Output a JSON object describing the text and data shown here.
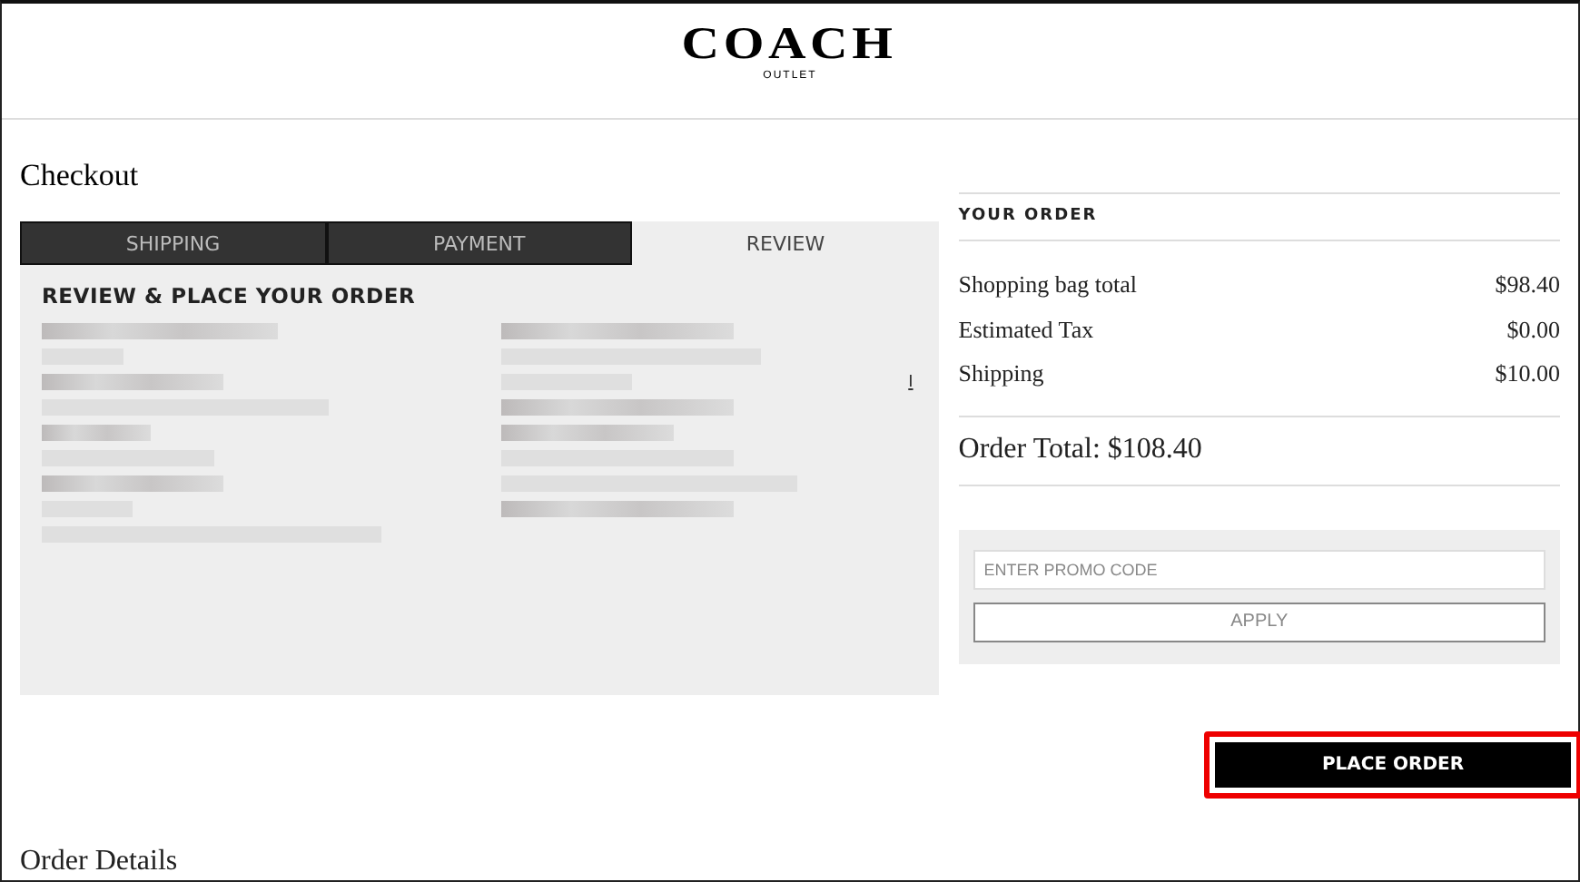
{
  "header": {
    "logo": "COACH",
    "sublogo": "OUTLET"
  },
  "page_title": "Checkout",
  "tabs": [
    {
      "label": "SHIPPING",
      "selected": false
    },
    {
      "label": "PAYMENT",
      "selected": false
    },
    {
      "label": "REVIEW",
      "selected": true
    }
  ],
  "review": {
    "heading": "REVIEW & PLACE YOUR ORDER",
    "edit_link": "I"
  },
  "summary": {
    "heading": "YOUR ORDER",
    "lines": [
      {
        "label": "Shopping bag total",
        "amount": "$98.40"
      },
      {
        "label": "Estimated Tax",
        "amount": "$0.00"
      },
      {
        "label": "Shipping",
        "amount": "$10.00"
      }
    ],
    "total": "Order Total: $108.40"
  },
  "promo": {
    "placeholder": "ENTER PROMO CODE",
    "button": "APPLY"
  },
  "place_order": {
    "label": "PLACE ORDER",
    "highlighted": true
  },
  "section_title": "Order Details"
}
